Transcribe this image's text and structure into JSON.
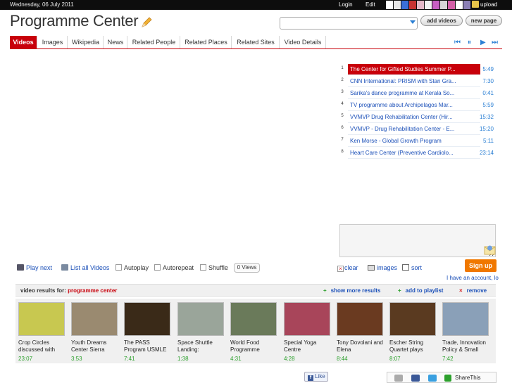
{
  "topbar": {
    "date": "Wednesday, 06 July 2011",
    "login": "Login",
    "edit": "Edit",
    "upload": "upload",
    "swatches": [
      "#ffffff",
      "#e8e8e8",
      "#3a6fd8",
      "#c83232",
      "#e4b8c8",
      "#f2f2f2",
      "#c75fc3",
      "#d6d6d6",
      "#d35fa7",
      "#ffffff",
      "#8b7fb5"
    ]
  },
  "header": {
    "title": "Programme Center",
    "search_placeholder": "",
    "add_videos": "add videos",
    "new_page": "new page"
  },
  "tabs": [
    "Videos",
    "Images",
    "Wikipedia",
    "News",
    "Related People",
    "Related Places",
    "Related Sites",
    "Video Details"
  ],
  "player_controls": {
    "first": "⏮",
    "pause": "⏸",
    "next": "▶",
    "last": "⏭"
  },
  "playlist": [
    {
      "num": "1",
      "title": "The Center for Gifted Studies Summer P...",
      "duration": "5:49"
    },
    {
      "num": "2",
      "title": "CNN International: PRISM with Stan Gra...",
      "duration": "7:30"
    },
    {
      "num": "3",
      "title": "Sarika's dance programme at Kerala So...",
      "duration": "0:41"
    },
    {
      "num": "4",
      "title": "TV programme about Archipelagos Mar...",
      "duration": "5:59"
    },
    {
      "num": "5",
      "title": "VVMVP Drug Rehabilitation Center (Hir...",
      "duration": "15:32"
    },
    {
      "num": "6",
      "title": "VVMVP - Drug Rehabilitation Center - E...",
      "duration": "15:20"
    },
    {
      "num": "7",
      "title": "Ken Morse - Global Growth Program",
      "duration": "5:11"
    },
    {
      "num": "8",
      "title": "Heart Care Center (Preventive Cardiolo...",
      "duration": "23:14"
    }
  ],
  "controls": {
    "play_next": "Play next",
    "list_all": "List all Videos",
    "autoplay": "Autoplay",
    "autorepeat": "Autorepeat",
    "shuffle": "Shuffle",
    "views": "0 Views",
    "clear": "clear",
    "images": "images",
    "sort": "sort",
    "signup": "Sign up",
    "account": "I have an account, lo"
  },
  "results": {
    "label": "video results for:",
    "query": "programme center",
    "show_more": "show more results",
    "add_playlist": "add to playlist",
    "remove": "remove"
  },
  "thumbnails": [
    {
      "title": "Crop Circles discussed with",
      "duration": "23:07",
      "color": "#c8c850"
    },
    {
      "title": "Youth Dreams Center Sierra",
      "duration": "3:53",
      "color": "#9a8a70"
    },
    {
      "title": "The PASS Program USMLE",
      "duration": "7:41",
      "color": "#3a2a18"
    },
    {
      "title": "Space Shuttle Landing:",
      "duration": "1:38",
      "color": "#9aa59a"
    },
    {
      "title": "World Food Programme",
      "duration": "4:31",
      "color": "#6a7a5a"
    },
    {
      "title": "Special Yoga Centre",
      "duration": "4:28",
      "color": "#a8455a"
    },
    {
      "title": "Tony Dovolani and Elena",
      "duration": "8:44",
      "color": "#6a3a20"
    },
    {
      "title": "Escher String Quartet plays",
      "duration": "8:07",
      "color": "#5a3a20"
    },
    {
      "title": "Trade, Innovation Policy & Small",
      "duration": "7:42",
      "color": "#8aa0b8"
    }
  ],
  "social": {
    "like": "Like",
    "sharethis": "ShareThis"
  }
}
